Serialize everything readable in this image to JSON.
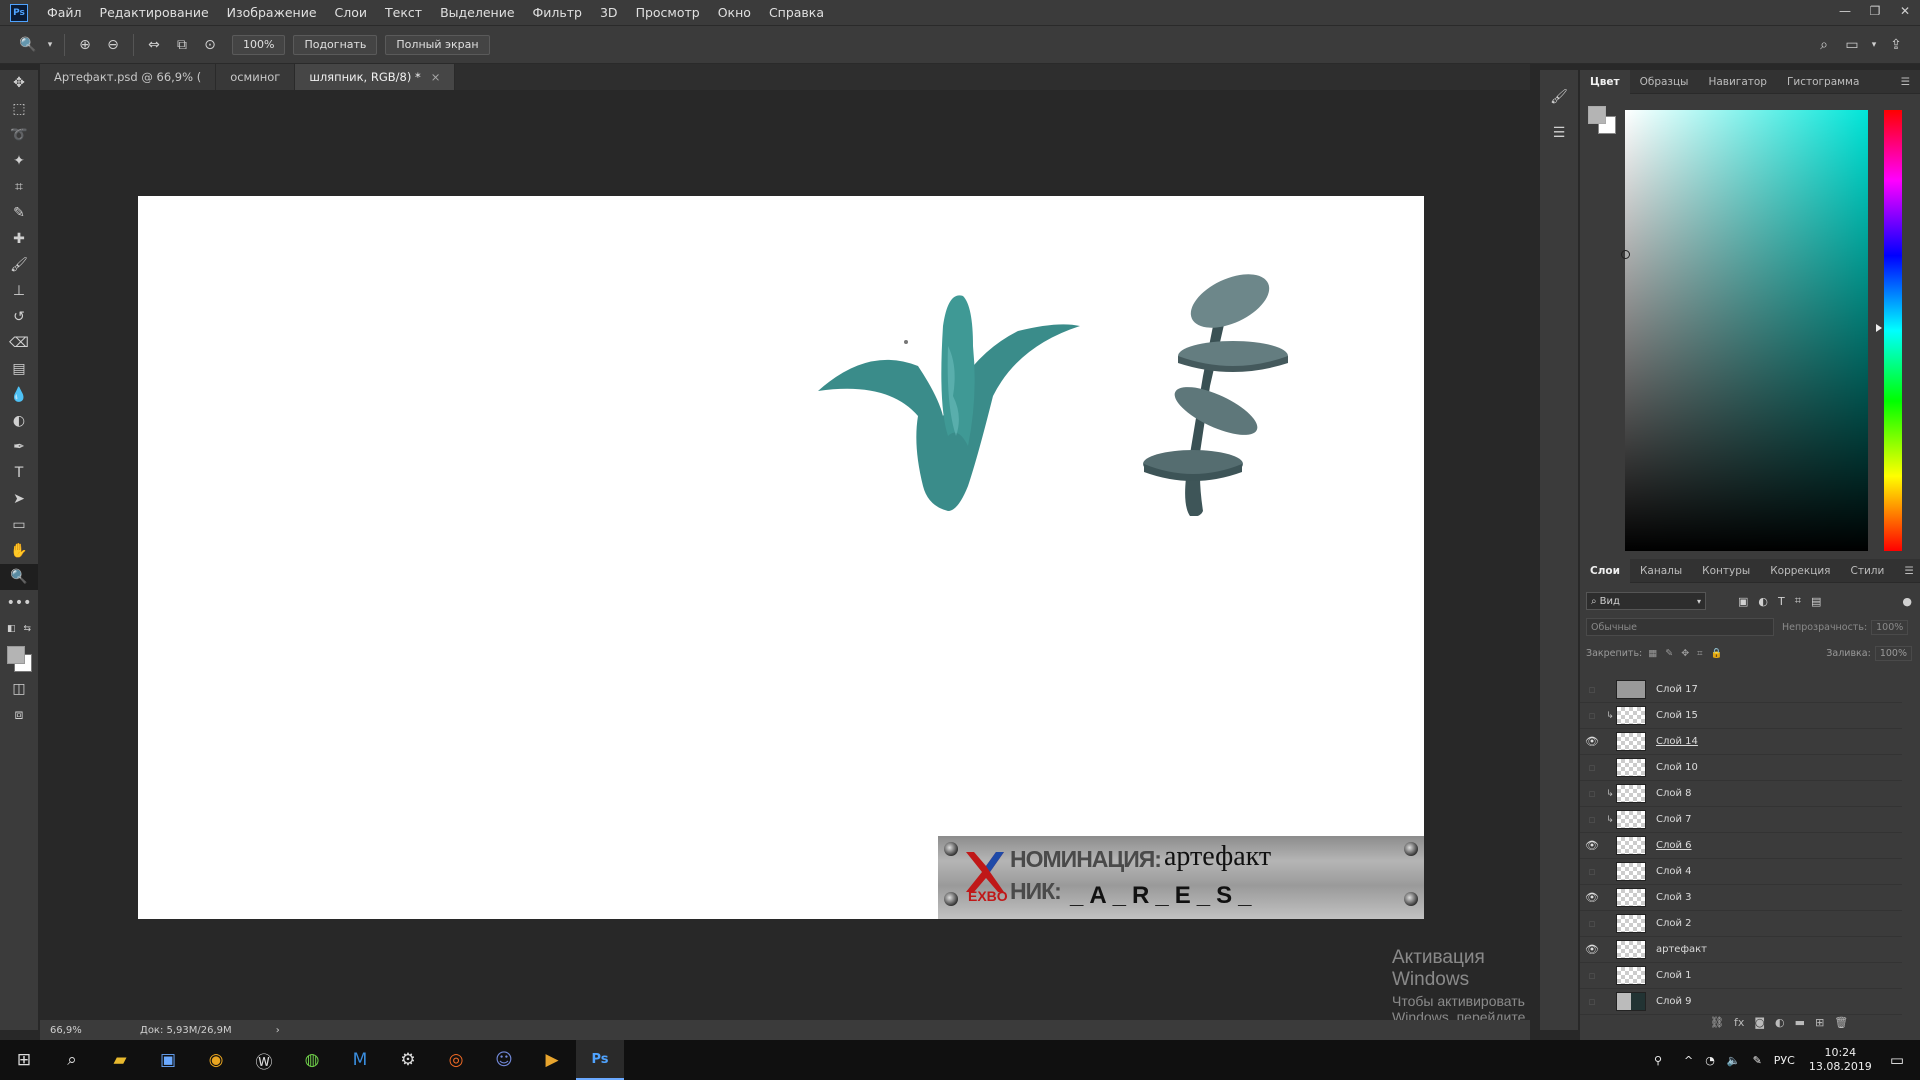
{
  "app": {
    "logo": "Ps"
  },
  "menu": [
    "Файл",
    "Редактирование",
    "Изображение",
    "Слои",
    "Текст",
    "Выделение",
    "Фильтр",
    "3D",
    "Просмотр",
    "Окно",
    "Справка"
  ],
  "options": {
    "zoom_value": "100%",
    "fit_label": "Подогнать",
    "fullscreen_label": "Полный экран"
  },
  "tabs": [
    {
      "label": "Артефакт.psd @ 66,9% (",
      "active": false
    },
    {
      "label": "осминог",
      "active": false
    },
    {
      "label": "шляпник, RGB/8) *",
      "active": true,
      "close": "×"
    }
  ],
  "status": {
    "zoom": "66,9%",
    "doc": "Док: 5,93M/26,9M",
    "arrow": "›"
  },
  "banner": {
    "nomination_label": "НОМИНАЦИЯ:",
    "nomination_value": "артефакт",
    "nick_label": "НИК:",
    "nick_value": "_A_R_E_S_",
    "logo_text": "EXBO"
  },
  "color_panel": {
    "tabs": [
      "Цвет",
      "Образцы",
      "Навигатор",
      "Гистограмма"
    ],
    "hue_color": "#00e5d8"
  },
  "layers_panel": {
    "tabs": [
      "Слои",
      "Каналы",
      "Контуры",
      "Коррекция",
      "Стили"
    ],
    "filter_label": "Вид",
    "blend_mode": "Обычные",
    "opacity_label": "Непрозрачность:",
    "opacity_value": "100%",
    "lock_label": "Закрепить:",
    "fill_label": "Заливка:",
    "fill_value": "100%",
    "layers": [
      {
        "name": "Слой 17",
        "visible": false,
        "clipped": false,
        "linked": false,
        "thumb": "gray"
      },
      {
        "name": "Слой 15",
        "visible": false,
        "clipped": true,
        "linked": false,
        "thumb": "mixed"
      },
      {
        "name": "Слой 14",
        "visible": true,
        "clipped": false,
        "linked": true,
        "thumb": "checker"
      },
      {
        "name": "Слой 10",
        "visible": false,
        "clipped": false,
        "linked": false,
        "thumb": "checker"
      },
      {
        "name": "Слой 8",
        "visible": false,
        "clipped": true,
        "linked": false,
        "thumb": "checker"
      },
      {
        "name": "Слой 7",
        "visible": false,
        "clipped": true,
        "linked": false,
        "thumb": "checker"
      },
      {
        "name": "Слой 6",
        "visible": true,
        "clipped": false,
        "linked": true,
        "thumb": "checker"
      },
      {
        "name": "Слой 4",
        "visible": false,
        "clipped": false,
        "linked": false,
        "thumb": "checker"
      },
      {
        "name": "Слой 3",
        "visible": true,
        "clipped": false,
        "linked": false,
        "thumb": "checker"
      },
      {
        "name": "Слой 2",
        "visible": false,
        "clipped": false,
        "linked": false,
        "thumb": "checker"
      },
      {
        "name": "артефакт",
        "visible": true,
        "clipped": false,
        "linked": false,
        "thumb": "checker"
      },
      {
        "name": "Слой 1",
        "visible": false,
        "clipped": false,
        "linked": false,
        "thumb": "checker"
      },
      {
        "name": "Слой 9",
        "visible": false,
        "clipped": false,
        "linked": false,
        "thumb": "dark"
      }
    ]
  },
  "watermark": {
    "title": "Активация Windows",
    "text": "Чтобы активировать Windows, перейдите в раздел \"Параметры\"."
  },
  "taskbar": {
    "lang": "РУС",
    "time": "10:24",
    "date": "13.08.2019"
  }
}
